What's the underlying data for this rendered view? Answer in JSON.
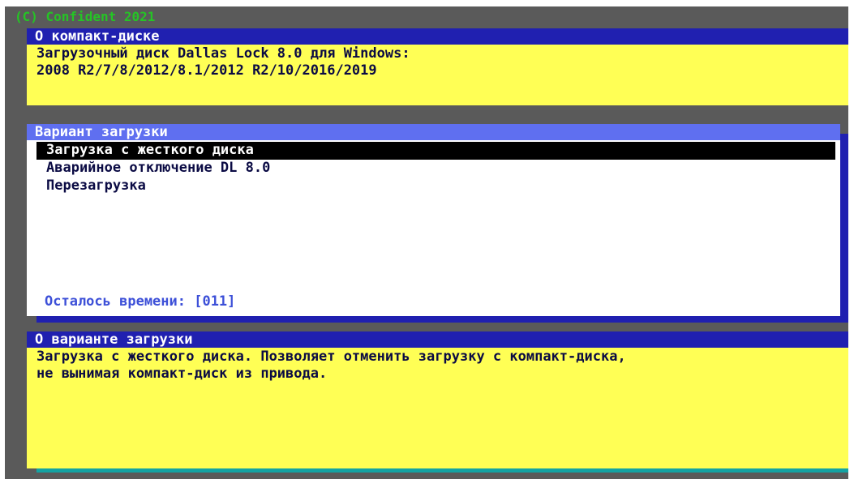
{
  "copyright": "(C) Confident 2021",
  "about_cd": {
    "title": "О компакт-диске",
    "lines": [
      "Загрузочный диск Dallas Lock 8.0 для Windows:",
      "2008 R2/7/8/2012/8.1/2012 R2/10/2016/2019"
    ]
  },
  "boot_menu": {
    "title": "Вариант загрузки",
    "items": [
      {
        "label": "Загрузка с жесткого диска",
        "selected": true
      },
      {
        "label": "Аварийное отключение DL 8.0",
        "selected": false
      },
      {
        "label": "Перезагрузка",
        "selected": false
      }
    ],
    "timer_text": "Осталось времени: [011]"
  },
  "about_boot": {
    "title": "О варианте загрузки",
    "lines": [
      "Загрузка с жесткого диска. Позволяет отменить загрузку с компакт-диска,",
      "не вынимая компакт-диск из привода."
    ]
  },
  "colors": {
    "background": "#5a5a5a",
    "title_bar": "#2020b0",
    "menu_title_bar": "#5f6ff0",
    "info_background": "#ffff55",
    "menu_background": "#ffffff",
    "selection": "#000000",
    "copyright_text": "#25c425",
    "timer_text": "#3d50d8"
  }
}
